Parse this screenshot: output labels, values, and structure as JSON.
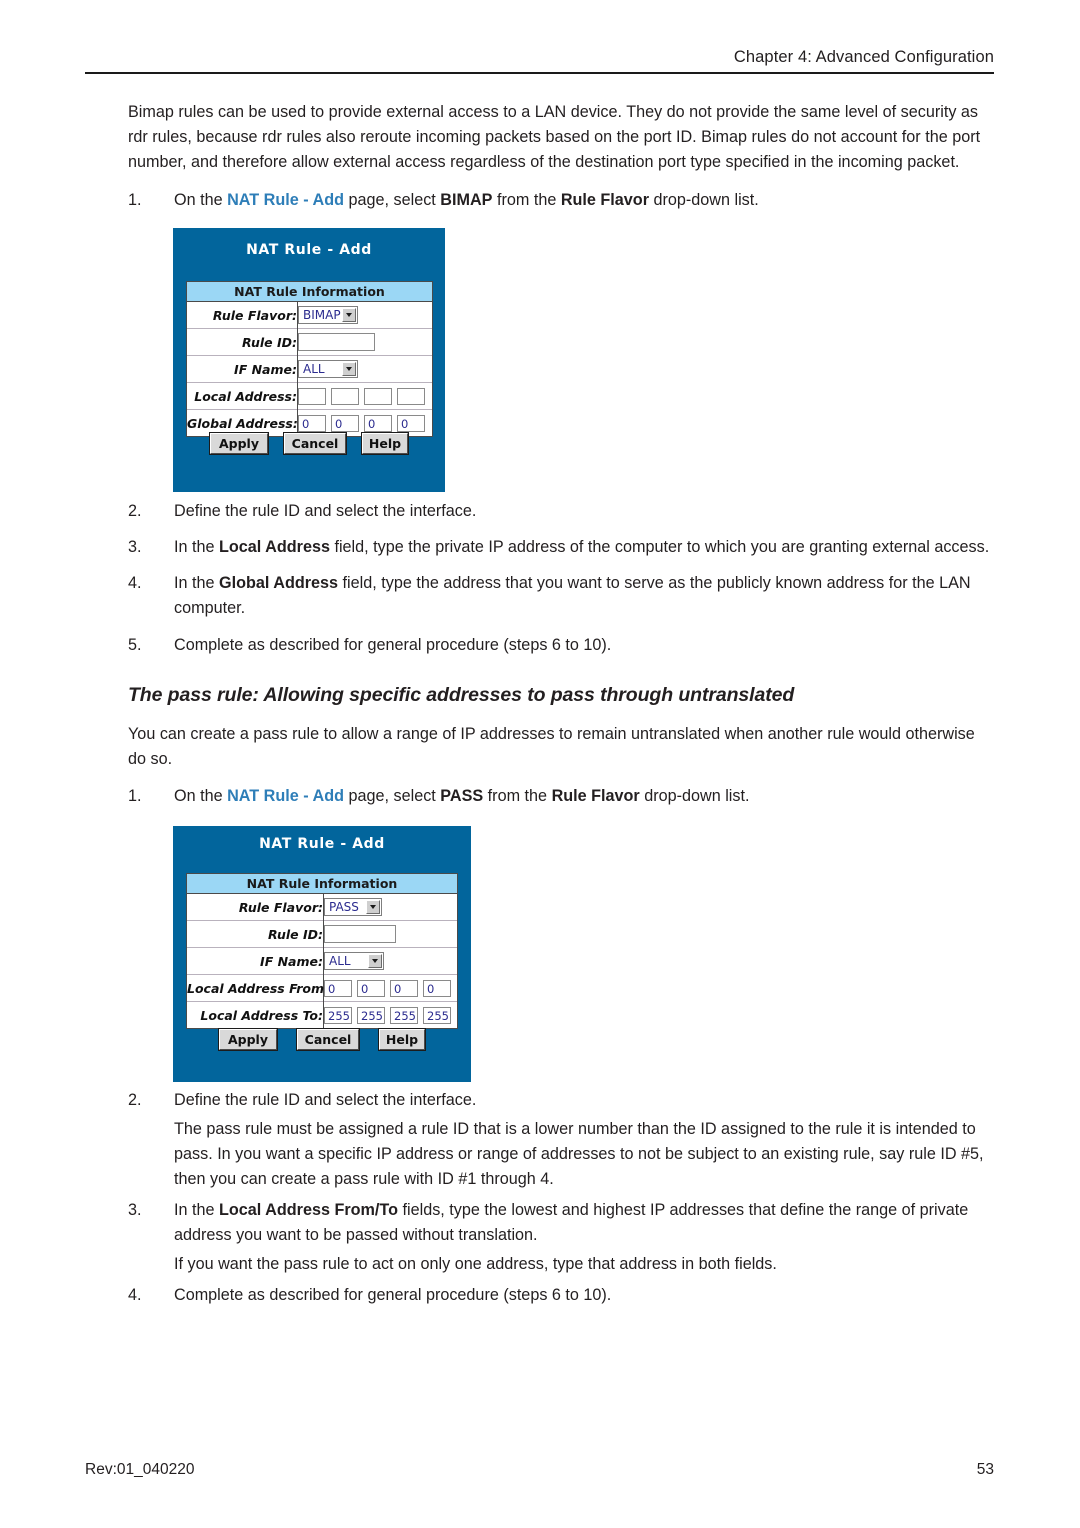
{
  "header": {
    "chapter": "Chapter 4: Advanced Configuration"
  },
  "footer": {
    "revision": "Rev:01_040220",
    "page_number": "53"
  },
  "intro": {
    "paragraph": "Bimap rules can be used to provide external access to a LAN device. They do not provide the same level of security as rdr rules, because rdr rules also reroute incoming packets based on the port ID. Bimap rules do not account for the port number, and therefore allow external access regardless of the destination port type specified in the incoming packet."
  },
  "bimap_steps": {
    "step1": {
      "num": "1.",
      "pre": "On the ",
      "link": "NAT Rule - Add",
      "mid": " page, select ",
      "bold1": "BIMAP",
      "mid2": " from the ",
      "bold2": "Rule Flavor",
      "post": " drop-down list."
    },
    "step2": {
      "num": "2.",
      "text": "Define the rule ID and select the interface."
    },
    "step3": {
      "num": "3.",
      "pre": "In the ",
      "bold": "Local Address",
      "post": " field, type the private IP address of the computer to which you are granting external access."
    },
    "step4": {
      "num": "4.",
      "pre": "In the ",
      "bold": "Global Address",
      "post": " field, type the address that you want to serve as the publicly known address for the LAN computer."
    },
    "step5": {
      "num": "5.",
      "text": "Complete as described for general procedure (steps 6 to 10)."
    }
  },
  "pass_section": {
    "heading": "The pass rule: Allowing specific addresses to pass through untranslated",
    "paragraph": "You can create a pass rule to allow a range of IP addresses to remain untranslated when another rule would otherwise do so.",
    "step1": {
      "num": "1.",
      "pre": "On the ",
      "link": "NAT Rule - Add",
      "mid": " page, select ",
      "bold1": "PASS",
      "mid2": " from the ",
      "bold2": "Rule Flavor",
      "post": " drop-down list."
    },
    "step2": {
      "num": "2.",
      "text": "Define the rule ID and select the interface.",
      "sub": "The pass rule must be assigned a rule ID that is a lower number than the ID assigned to the rule it is intended to pass. In you want a specific IP address or range of addresses to not be subject to an existing rule, say rule ID #5, then you can create a pass rule with ID #1 through 4."
    },
    "step3": {
      "num": "3.",
      "pre": "In the ",
      "bold": "Local Address From/To",
      "post": " fields, type the lowest and highest IP addresses that define the range of private address you want to be passed without translation.",
      "sub": "If you want the pass rule to act on only one address, type that address in both fields."
    },
    "step4": {
      "num": "4.",
      "text": "Complete as described for general procedure (steps 6 to 10)."
    }
  },
  "dialog_bimap": {
    "title": "NAT Rule - Add",
    "panel_header": "NAT Rule Information",
    "rows": {
      "rule_flavor_label": "Rule Flavor:",
      "rule_flavor_value": "BIMAP",
      "rule_id_label": "Rule ID:",
      "rule_id_value": "",
      "if_name_label": "IF Name:",
      "if_name_value": "ALL",
      "local_address_label": "Local Address:",
      "local_address_octets": [
        "",
        "",
        "",
        ""
      ],
      "global_address_label": "Global Address:",
      "global_address_octets": [
        "0",
        "0",
        "0",
        "0"
      ]
    },
    "buttons": {
      "apply": "Apply",
      "cancel": "Cancel",
      "help": "Help"
    }
  },
  "dialog_pass": {
    "title": "NAT Rule - Add",
    "panel_header": "NAT Rule Information",
    "rows": {
      "rule_flavor_label": "Rule Flavor:",
      "rule_flavor_value": "PASS",
      "rule_id_label": "Rule ID:",
      "rule_id_value": "",
      "if_name_label": "IF Name:",
      "if_name_value": "ALL",
      "addr_from_label": "Local Address From:",
      "addr_from_octets": [
        "0",
        "0",
        "0",
        "0"
      ],
      "addr_to_label": "Local Address To:",
      "addr_to_octets": [
        "255",
        "255",
        "255",
        "255"
      ]
    },
    "buttons": {
      "apply": "Apply",
      "cancel": "Cancel",
      "help": "Help"
    }
  },
  "colors": {
    "dialog_blue": "#02659c",
    "panel_header_blue": "#9bd7f5",
    "link_blue": "#2e7eb8",
    "field_text_blue": "#2b2b8f"
  }
}
